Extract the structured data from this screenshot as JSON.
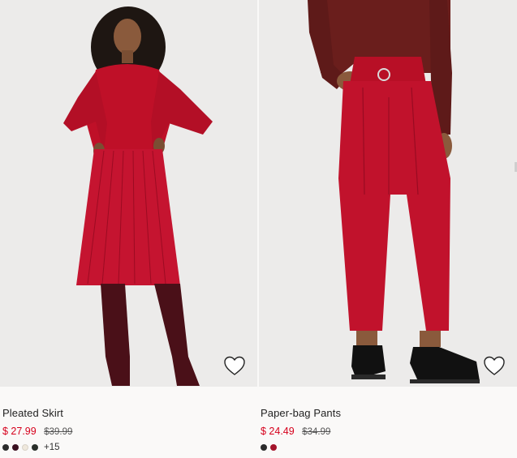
{
  "products": [
    {
      "title": "Pleated Skirt",
      "price": "$ 27.99",
      "original_price": "$39.99",
      "swatches": [
        "#2b2b2b",
        "#3a1020",
        "#efe8dc",
        "#2a2f2a"
      ],
      "more_colors": "+15",
      "favorite_icon": "heart-outline-icon"
    },
    {
      "title": "Paper-bag Pants",
      "price": "$ 24.49",
      "original_price": "$34.99",
      "swatches": [
        "#2b2b2b",
        "#a3132a"
      ],
      "favorite_icon": "heart-outline-icon"
    }
  ],
  "colors": {
    "sale_price": "#d6001c",
    "background": "#faf9f8",
    "image_background": "#ecebea",
    "garment_red": "#bf1028"
  }
}
